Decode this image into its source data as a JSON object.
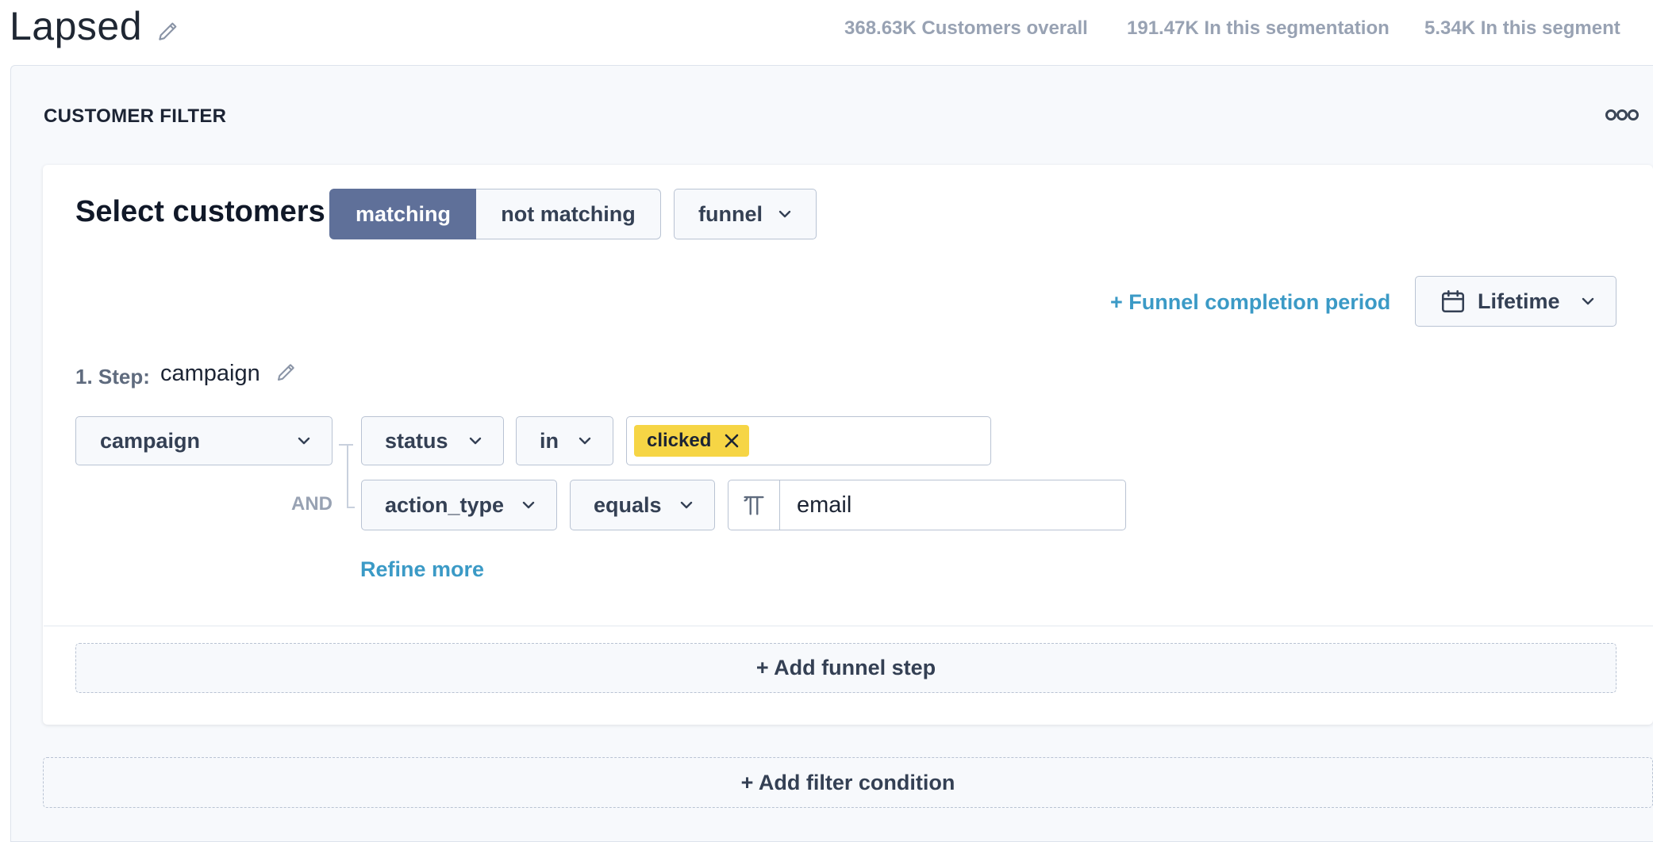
{
  "header": {
    "title": "Lapsed",
    "stats": {
      "overall": "368.63K Customers overall",
      "segmentation": "191.47K In this segmentation",
      "segment": "5.34K In this segment"
    }
  },
  "filter": {
    "heading": "CUSTOMER FILTER",
    "more_icon": "more-horizontal-icon",
    "select_label": "Select customers",
    "match_toggle": {
      "options": [
        "matching",
        "not matching"
      ],
      "selected": "matching"
    },
    "mode_select": "funnel",
    "completion_period_link": "+ Funnel completion period",
    "period_select": "Lifetime",
    "steps": [
      {
        "label": "1. Step:",
        "name": "campaign",
        "event": "campaign",
        "conditions": [
          {
            "property": "status",
            "operator": "in",
            "values": [
              "clicked"
            ]
          },
          {
            "joiner": "AND",
            "property": "action_type",
            "operator": "equals",
            "value_type_icon": "text-type-icon",
            "value": "email"
          }
        ],
        "refine_link": "Refine more"
      }
    ],
    "add_step_button": "+ Add funnel step",
    "add_condition_button": "+ Add filter condition"
  },
  "colors": {
    "accent": "#5f7099",
    "link": "#3b9ac6",
    "tag": "#f6d545",
    "muted": "#98a2b3"
  }
}
